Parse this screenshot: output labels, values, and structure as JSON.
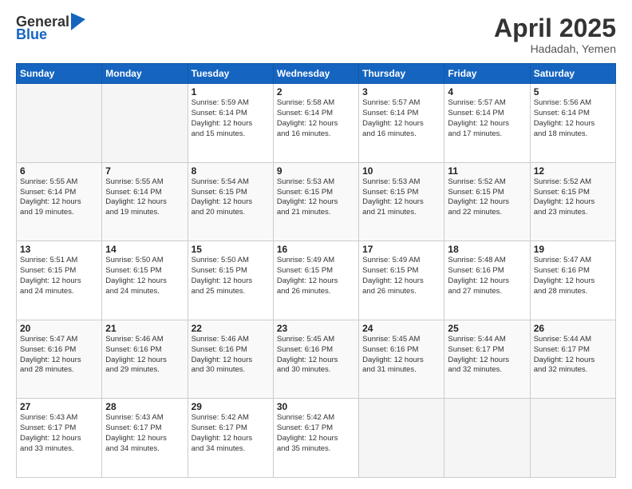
{
  "header": {
    "logo_general": "General",
    "logo_blue": "Blue",
    "title": "April 2025",
    "location": "Hadadah, Yemen"
  },
  "days_of_week": [
    "Sunday",
    "Monday",
    "Tuesday",
    "Wednesday",
    "Thursday",
    "Friday",
    "Saturday"
  ],
  "weeks": [
    [
      {
        "day": "",
        "info": ""
      },
      {
        "day": "",
        "info": ""
      },
      {
        "day": "1",
        "info": "Sunrise: 5:59 AM\nSunset: 6:14 PM\nDaylight: 12 hours\nand 15 minutes."
      },
      {
        "day": "2",
        "info": "Sunrise: 5:58 AM\nSunset: 6:14 PM\nDaylight: 12 hours\nand 16 minutes."
      },
      {
        "day": "3",
        "info": "Sunrise: 5:57 AM\nSunset: 6:14 PM\nDaylight: 12 hours\nand 16 minutes."
      },
      {
        "day": "4",
        "info": "Sunrise: 5:57 AM\nSunset: 6:14 PM\nDaylight: 12 hours\nand 17 minutes."
      },
      {
        "day": "5",
        "info": "Sunrise: 5:56 AM\nSunset: 6:14 PM\nDaylight: 12 hours\nand 18 minutes."
      }
    ],
    [
      {
        "day": "6",
        "info": "Sunrise: 5:55 AM\nSunset: 6:14 PM\nDaylight: 12 hours\nand 19 minutes."
      },
      {
        "day": "7",
        "info": "Sunrise: 5:55 AM\nSunset: 6:14 PM\nDaylight: 12 hours\nand 19 minutes."
      },
      {
        "day": "8",
        "info": "Sunrise: 5:54 AM\nSunset: 6:15 PM\nDaylight: 12 hours\nand 20 minutes."
      },
      {
        "day": "9",
        "info": "Sunrise: 5:53 AM\nSunset: 6:15 PM\nDaylight: 12 hours\nand 21 minutes."
      },
      {
        "day": "10",
        "info": "Sunrise: 5:53 AM\nSunset: 6:15 PM\nDaylight: 12 hours\nand 21 minutes."
      },
      {
        "day": "11",
        "info": "Sunrise: 5:52 AM\nSunset: 6:15 PM\nDaylight: 12 hours\nand 22 minutes."
      },
      {
        "day": "12",
        "info": "Sunrise: 5:52 AM\nSunset: 6:15 PM\nDaylight: 12 hours\nand 23 minutes."
      }
    ],
    [
      {
        "day": "13",
        "info": "Sunrise: 5:51 AM\nSunset: 6:15 PM\nDaylight: 12 hours\nand 24 minutes."
      },
      {
        "day": "14",
        "info": "Sunrise: 5:50 AM\nSunset: 6:15 PM\nDaylight: 12 hours\nand 24 minutes."
      },
      {
        "day": "15",
        "info": "Sunrise: 5:50 AM\nSunset: 6:15 PM\nDaylight: 12 hours\nand 25 minutes."
      },
      {
        "day": "16",
        "info": "Sunrise: 5:49 AM\nSunset: 6:15 PM\nDaylight: 12 hours\nand 26 minutes."
      },
      {
        "day": "17",
        "info": "Sunrise: 5:49 AM\nSunset: 6:15 PM\nDaylight: 12 hours\nand 26 minutes."
      },
      {
        "day": "18",
        "info": "Sunrise: 5:48 AM\nSunset: 6:16 PM\nDaylight: 12 hours\nand 27 minutes."
      },
      {
        "day": "19",
        "info": "Sunrise: 5:47 AM\nSunset: 6:16 PM\nDaylight: 12 hours\nand 28 minutes."
      }
    ],
    [
      {
        "day": "20",
        "info": "Sunrise: 5:47 AM\nSunset: 6:16 PM\nDaylight: 12 hours\nand 28 minutes."
      },
      {
        "day": "21",
        "info": "Sunrise: 5:46 AM\nSunset: 6:16 PM\nDaylight: 12 hours\nand 29 minutes."
      },
      {
        "day": "22",
        "info": "Sunrise: 5:46 AM\nSunset: 6:16 PM\nDaylight: 12 hours\nand 30 minutes."
      },
      {
        "day": "23",
        "info": "Sunrise: 5:45 AM\nSunset: 6:16 PM\nDaylight: 12 hours\nand 30 minutes."
      },
      {
        "day": "24",
        "info": "Sunrise: 5:45 AM\nSunset: 6:16 PM\nDaylight: 12 hours\nand 31 minutes."
      },
      {
        "day": "25",
        "info": "Sunrise: 5:44 AM\nSunset: 6:17 PM\nDaylight: 12 hours\nand 32 minutes."
      },
      {
        "day": "26",
        "info": "Sunrise: 5:44 AM\nSunset: 6:17 PM\nDaylight: 12 hours\nand 32 minutes."
      }
    ],
    [
      {
        "day": "27",
        "info": "Sunrise: 5:43 AM\nSunset: 6:17 PM\nDaylight: 12 hours\nand 33 minutes."
      },
      {
        "day": "28",
        "info": "Sunrise: 5:43 AM\nSunset: 6:17 PM\nDaylight: 12 hours\nand 34 minutes."
      },
      {
        "day": "29",
        "info": "Sunrise: 5:42 AM\nSunset: 6:17 PM\nDaylight: 12 hours\nand 34 minutes."
      },
      {
        "day": "30",
        "info": "Sunrise: 5:42 AM\nSunset: 6:17 PM\nDaylight: 12 hours\nand 35 minutes."
      },
      {
        "day": "",
        "info": ""
      },
      {
        "day": "",
        "info": ""
      },
      {
        "day": "",
        "info": ""
      }
    ]
  ]
}
